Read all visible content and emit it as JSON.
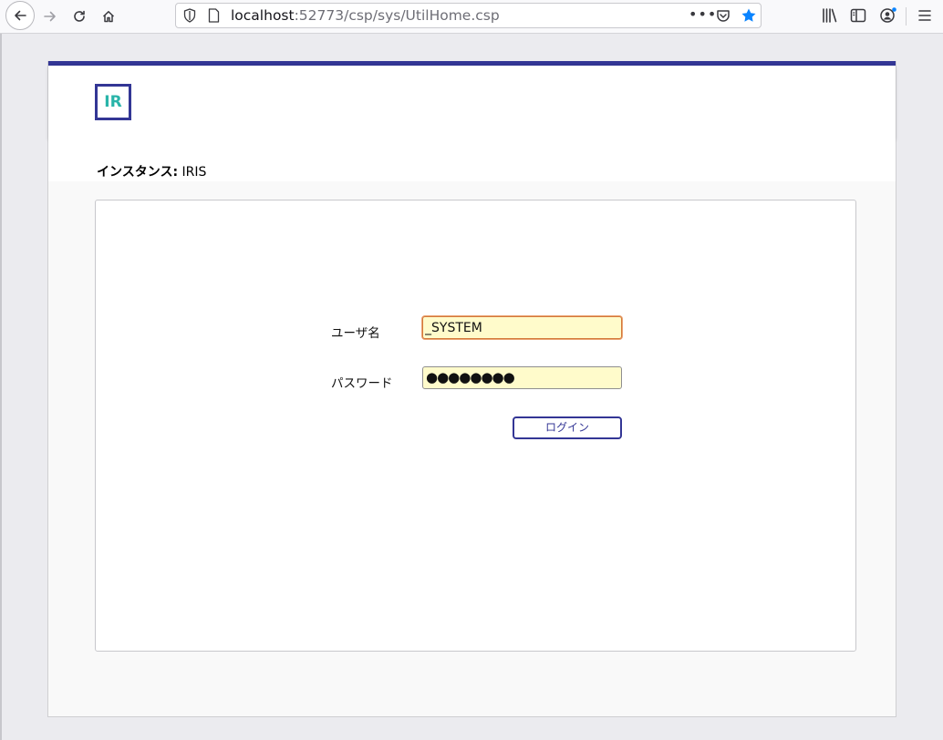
{
  "browser": {
    "url_host": "localhost",
    "url_rest": ":52773/csp/sys/UtilHome.csp",
    "more_label": "•••"
  },
  "page": {
    "logo_text": "IR",
    "instance_label": "インスタンス:",
    "instance_value": "IRIS"
  },
  "login": {
    "username_label": "ユーザ名",
    "username_value": "_SYSTEM",
    "password_label": "パスワード",
    "password_mask": "●●●●●●●●",
    "login_button_label": "ログイン"
  },
  "colors": {
    "accent": "#333695",
    "logo_text": "#29b4a9",
    "autofill_bg": "#fffbcb",
    "star": "#0a84ff"
  }
}
